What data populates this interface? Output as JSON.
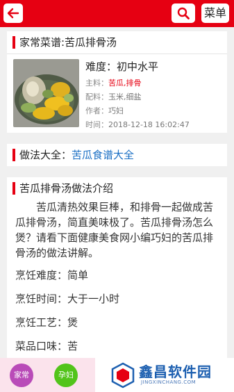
{
  "header": {
    "menu_label": "菜单"
  },
  "recipe_card": {
    "title": "家常菜谱:苦瓜排骨汤",
    "difficulty_label": "难度：",
    "difficulty_value": "初中水平",
    "main_label": "主料：",
    "main_value": "苦瓜,排骨",
    "seasoning_label": "配料：",
    "seasoning_value": "玉米,细盐",
    "author_label": "作者：",
    "author_value": "巧妇",
    "time_label": "时间：",
    "time_value": "2018-12-18 16:02:47"
  },
  "methods_card": {
    "label": "做法大全：",
    "link": "苦瓜食谱大全"
  },
  "intro_card": {
    "title": "苦瓜排骨汤做法介绍",
    "intro": "苦瓜清热效果巨棒，和排骨一起做成苦瓜排骨汤，简直美味极了。苦瓜排骨汤怎么煲？请看下面健康美食网小编巧妇的苦瓜排骨汤的做法讲解。",
    "specs": [
      "烹饪难度：简单",
      "烹饪时间：大于一小时",
      "烹饪工艺：煲",
      "菜品口味：苦"
    ]
  },
  "bottom": {
    "tag1": "家常",
    "tag2": "孕妇",
    "watermark": "鑫昌软件园",
    "watermark_sub": "JINGXINCHANG.COM"
  },
  "colors": {
    "brand_red": "#e60012",
    "link_blue": "#1a6fc4"
  },
  "icons": [
    "back-arrow-icon",
    "search-icon"
  ]
}
